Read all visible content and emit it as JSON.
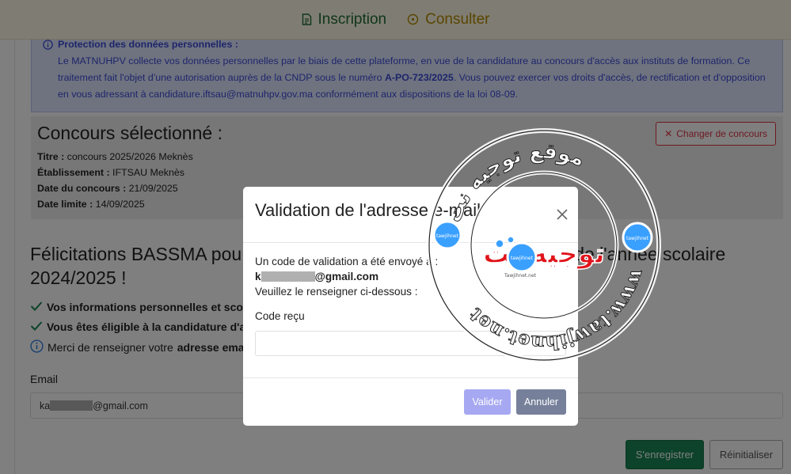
{
  "nav": {
    "inscription": "Inscription",
    "consulter": "Consulter",
    "accent": "#1f6b3a",
    "other_color": "#b58a00"
  },
  "privacy": {
    "title": "Protection des données personnelles :",
    "text1": "Le MATNUHPV collecte vos données personnelles par le biais de cette plateforme, en vue de la candidature au concours d'accès aux instituts de formation. Ce traitement fait l'objet d'une autorisation auprès de la CNDP sous le numéro ",
    "number": "A-PO-723/2025",
    "text2": ". Vous pouvez exercer vos droits d'accès, de rectification et d'opposition en vous adressant à candidature.iftsau@matnuhpv.gov.ma conformément aux dispositions de la loi 08-09."
  },
  "concours": {
    "heading": "Concours sélectionné :",
    "change_label": "Changer de concours",
    "titre_label": "Titre :",
    "titre_value": " concours 2025/2026 Meknès",
    "etab_label": "Établissement :",
    "etab_value": " IFTSAU Meknès",
    "date_label": "Date du concours :",
    "date_value": " 21/09/2025",
    "limite_label": "Date limite :",
    "limite_value": " 14/09/2025"
  },
  "main": {
    "felicitations_start": "Félicitations BASSMA pou",
    "felicitations_end": "de l'année scolaire",
    "year_line": "2024/2025 !",
    "check1": "Vos informations personnelles et scola",
    "check2": "Vous êtes éligible à la candidature d'ac",
    "info_text": "Merci de renseigner votre ",
    "info_bold": "adresse ema",
    "email_label": "Email",
    "email_prefix": "ka",
    "email_suffix": "@gmail.com",
    "register_label": "S'enregistrer",
    "reset_label": "Réinitialiser"
  },
  "modal": {
    "title": "Validation de l'adresse e-mail",
    "sent_text": "Un code de validation a été envoyé à :",
    "email_prefix": "k",
    "email_suffix": "@gmail.com",
    "instruction": "Veuillez le renseigner ci-dessous :",
    "code_label": "Code reçu",
    "code_value": "",
    "valider_label": "Valider",
    "annuler_label": "Annuler"
  },
  "watermark": {
    "arabic_logo": "توجيه نت",
    "arabic_ring": "موقع توجيه نت",
    "url": "www.tawjihnet.net",
    "small_brand": "tawjihnet",
    "small_url": "Tawjihnet.net"
  }
}
